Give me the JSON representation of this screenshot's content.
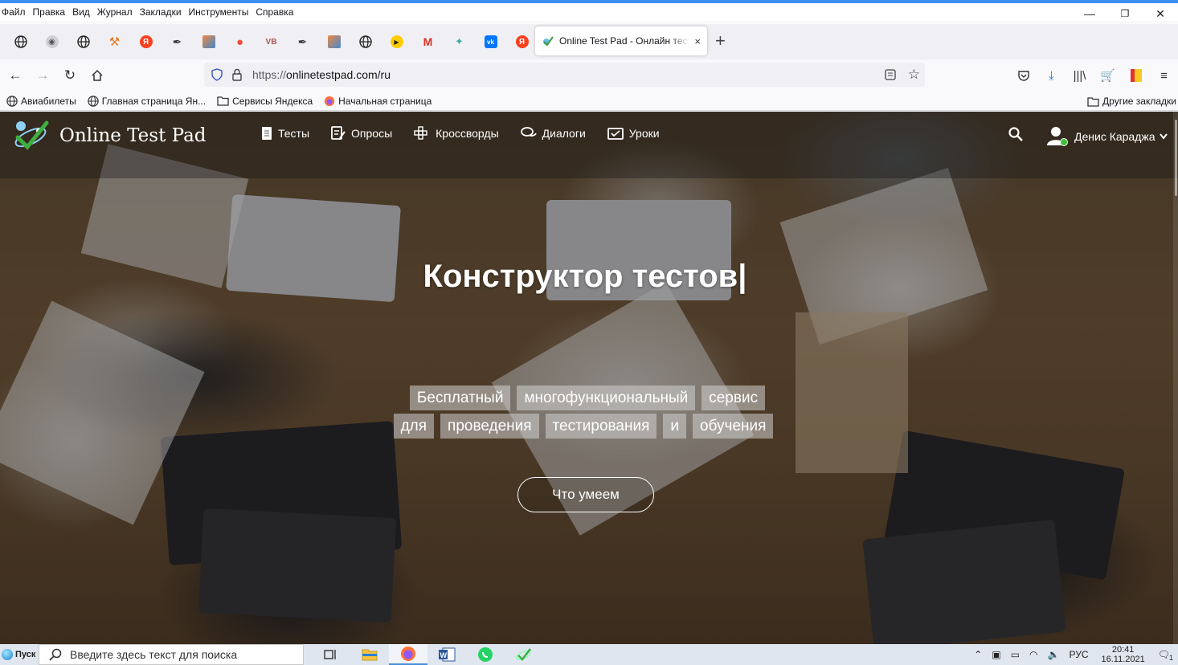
{
  "menubar": {
    "items": [
      "Файл",
      "Правка",
      "Вид",
      "Журнал",
      "Закладки",
      "Инструменты",
      "Справка"
    ]
  },
  "window_controls": {
    "minimize": "—",
    "restore": "❐",
    "close": "✕"
  },
  "tabs": {
    "pinned_icons": [
      "globe-icon",
      "yandex-browser-icon",
      "globe-icon",
      "tool-icon",
      "yandex-icon",
      "feather-icon",
      "image-icon",
      "apple-icon",
      "vk-cloud-icon",
      "feather-icon",
      "image-icon",
      "globe-icon",
      "play-icon",
      "gmail-icon",
      "otp-icon",
      "vk-icon",
      "yandex-icon"
    ],
    "active_tab_title": "Online Test Pad - Онлайн тесты",
    "close": "×",
    "new_tab": "+"
  },
  "navbar": {
    "url_prefix": "https://",
    "url_host": "onlinetestpad.com/ru"
  },
  "bookmarks": {
    "items": [
      {
        "label": "Авиабилеты",
        "icon": "globe-icon"
      },
      {
        "label": "Главная страница Ян...",
        "icon": "globe-icon"
      },
      {
        "label": "Сервисы Яндекса",
        "icon": "folder-icon"
      },
      {
        "label": "Начальная страница",
        "icon": "firefox-icon"
      }
    ],
    "other": "Другие закладки"
  },
  "site": {
    "logo": "Online Test Pad",
    "nav": [
      {
        "label": "Тесты",
        "icon": "test-icon"
      },
      {
        "label": "Опросы",
        "icon": "survey-icon"
      },
      {
        "label": "Кроссворды",
        "icon": "crossword-icon"
      },
      {
        "label": "Диалоги",
        "icon": "dialog-icon"
      },
      {
        "label": "Уроки",
        "icon": "lesson-icon"
      }
    ],
    "user_name": "Денис Караджа",
    "hero_title": "Конструктор тестов|",
    "tags_row1": [
      "Бесплатный",
      "многофункциональный",
      "сервис"
    ],
    "tags_row2": [
      "для",
      "проведения",
      "тестирования",
      "и",
      "обучения"
    ],
    "cta": "Что умеем"
  },
  "taskbar": {
    "start": "Пуск",
    "search_placeholder": "Введите здесь текст для поиска",
    "lang": "РУС",
    "time": "20:41",
    "date": "16.11.2021",
    "notif_count": "1"
  },
  "colors": {
    "accent": "#3d8ef0",
    "online": "#3fbf3f"
  }
}
